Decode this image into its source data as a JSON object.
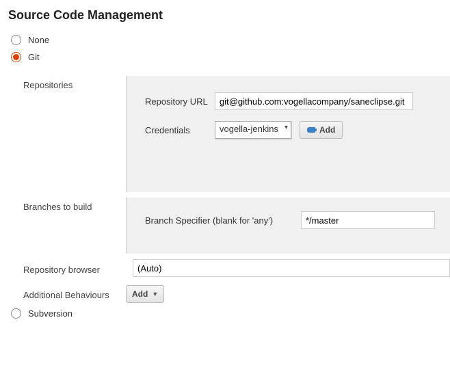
{
  "title": "Source Code Management",
  "scm_options": {
    "none": "None",
    "git": "Git",
    "subversion": "Subversion"
  },
  "selected_scm": "git",
  "repositories": {
    "section_label": "Repositories",
    "url_label": "Repository URL",
    "url_value": "git@github.com:vogellacompany/saneclipse.git",
    "credentials_label": "Credentials",
    "credentials_selected": "vogella-jenkins",
    "add_button": "Add"
  },
  "branches": {
    "section_label": "Branches to build",
    "specifier_label": "Branch Specifier (blank for 'any')",
    "specifier_value": "*/master"
  },
  "browser": {
    "label": "Repository browser",
    "value": "(Auto)"
  },
  "behaviours": {
    "label": "Additional Behaviours",
    "add_button": "Add"
  }
}
